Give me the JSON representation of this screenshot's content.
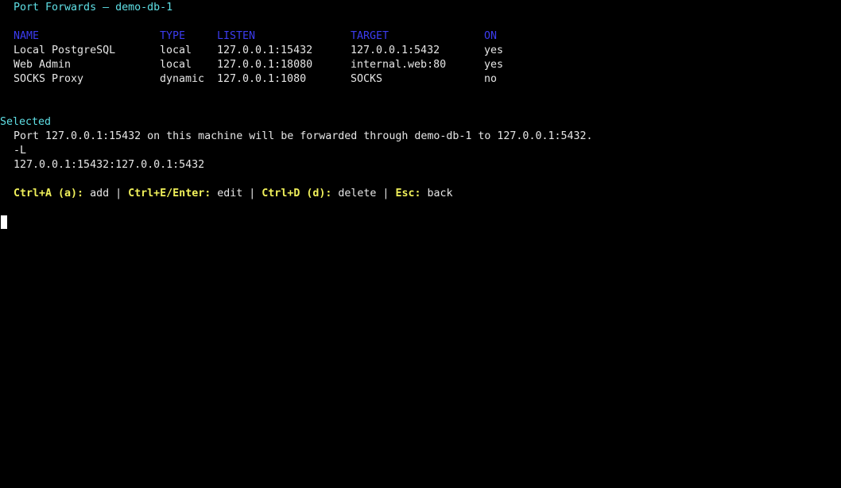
{
  "title": "Port Forwards — demo-db-1",
  "table": {
    "headers": {
      "name": "NAME",
      "type": "TYPE",
      "listen": "LISTEN",
      "target": "TARGET",
      "on": "ON"
    },
    "rows": [
      {
        "name": "Local PostgreSQL",
        "type": "local",
        "listen": "127.0.0.1:15432",
        "target": "127.0.0.1:5432",
        "on": "yes"
      },
      {
        "name": "Web Admin",
        "type": "local",
        "listen": "127.0.0.1:18080",
        "target": "internal.web:80",
        "on": "yes"
      },
      {
        "name": "SOCKS Proxy",
        "type": "dynamic",
        "listen": "127.0.0.1:1080",
        "target": "SOCKS",
        "on": "no"
      }
    ]
  },
  "selected": {
    "heading": "Selected",
    "description": "Port 127.0.0.1:15432 on this machine will be forwarded through demo-db-1 to 127.0.0.1:5432.",
    "flag": "-L",
    "spec": "127.0.0.1:15432:127.0.0.1:5432"
  },
  "keybinds": [
    {
      "key": "Ctrl+A (a):",
      "action": "add",
      "sep": " | "
    },
    {
      "key": "Ctrl+E/Enter:",
      "action": "edit",
      "sep": " | "
    },
    {
      "key": "Ctrl+D (d):",
      "action": "delete",
      "sep": " | "
    },
    {
      "key": "Esc:",
      "action": "back",
      "sep": ""
    }
  ],
  "colors": {
    "title": "#5fe0e6",
    "header": "#3c3cf0",
    "key": "#f0f05a",
    "text": "#e6e6e6",
    "background": "#000000"
  }
}
